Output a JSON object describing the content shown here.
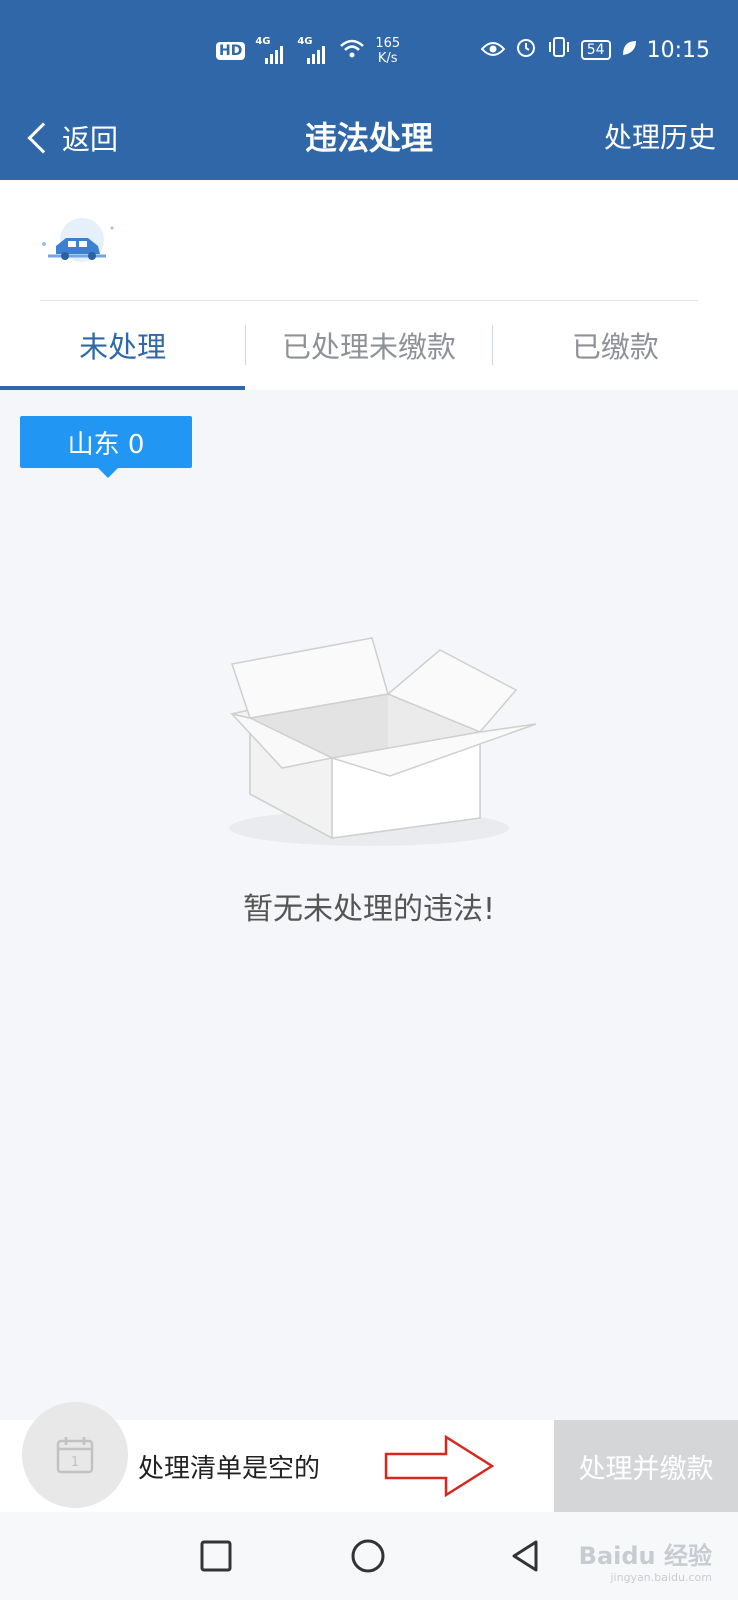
{
  "status_bar": {
    "hd": "HD",
    "net_tag_1": "4G",
    "net_tag_2": "4G",
    "speed_value": "165",
    "speed_unit": "K/s",
    "battery": "54",
    "time": "10:15"
  },
  "header": {
    "back_label": "返回",
    "title": "违法处理",
    "history_label": "处理历史",
    "background_color": "#2f67a8"
  },
  "tabs": [
    {
      "label": "未处理",
      "active": true
    },
    {
      "label": "已处理未缴款",
      "active": false
    },
    {
      "label": "已缴款",
      "active": false
    }
  ],
  "region": {
    "label": "山东 0",
    "color": "#2196f3"
  },
  "empty_state": {
    "message": "暂无未处理的违法!",
    "icon": "empty-box-icon"
  },
  "cart": {
    "calendar_day": "1",
    "text": "处理清单是空的",
    "pay_button_label": "处理并缴款"
  },
  "watermark": {
    "brand": "Baidu 经验",
    "url": "jingyan.baidu.com"
  }
}
